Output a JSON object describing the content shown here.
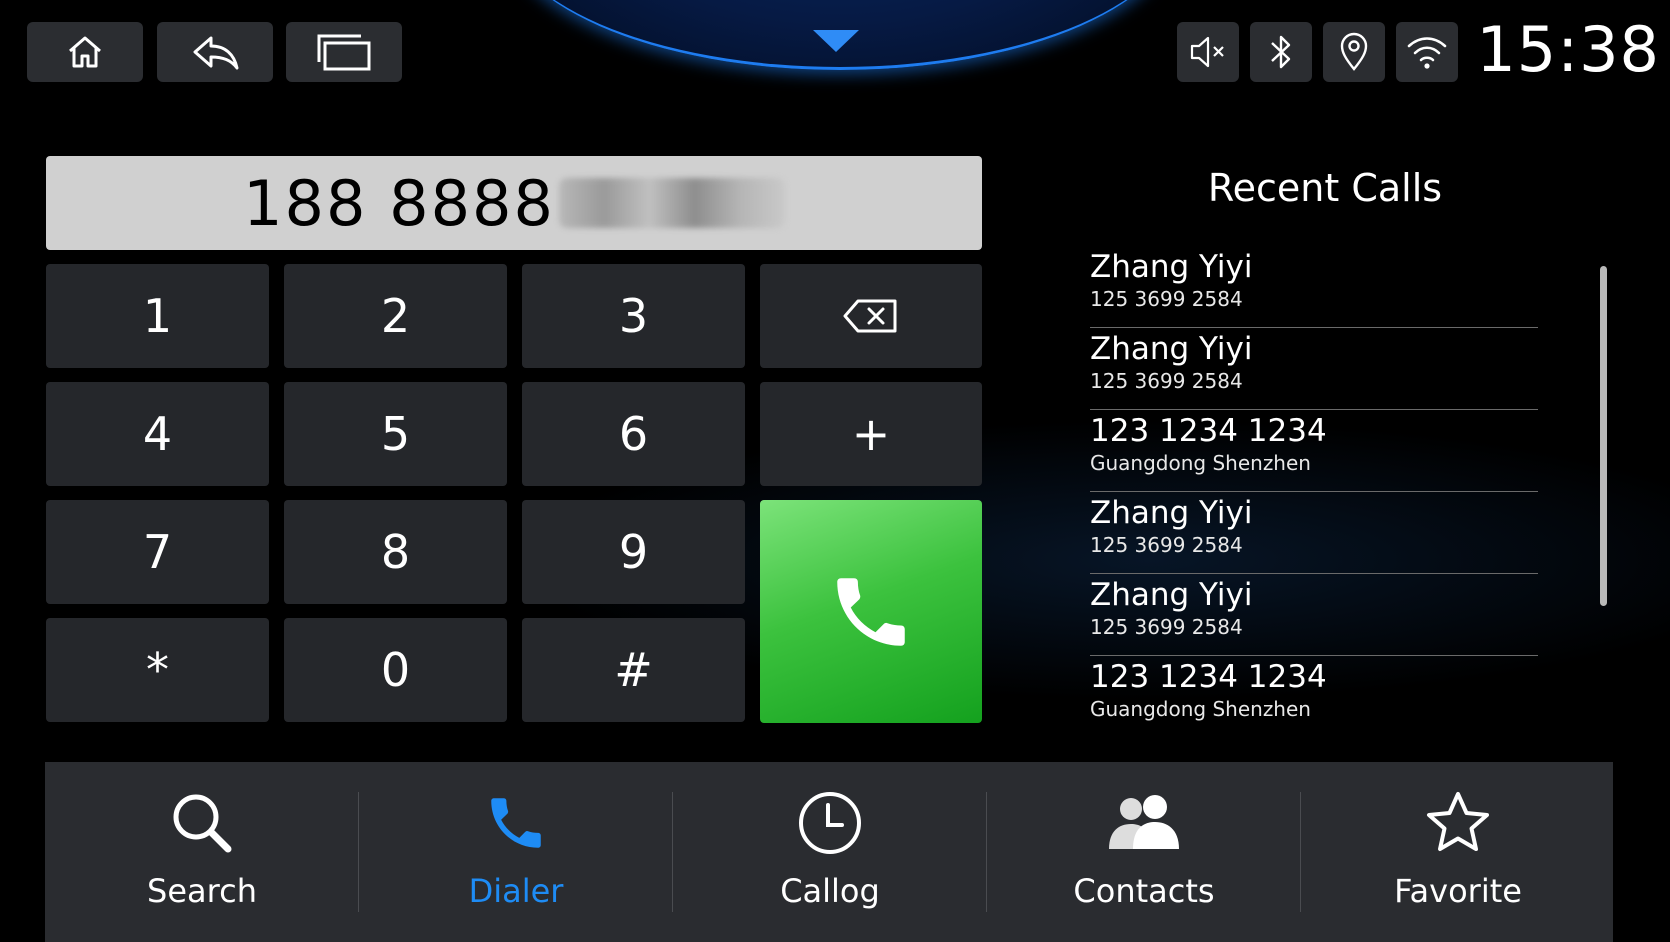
{
  "nav": {
    "home": "home-icon",
    "back": "back-icon",
    "recents": "recent-apps-icon"
  },
  "status": {
    "icons": [
      "mute-icon",
      "bluetooth-icon",
      "location-icon",
      "wifi-icon"
    ],
    "time": "15:38"
  },
  "dialer": {
    "number_visible": "188 8888",
    "keys": [
      "1",
      "2",
      "3",
      "4",
      "5",
      "6",
      "7",
      "8",
      "9",
      "*",
      "0",
      "#",
      "+"
    ],
    "call_color": "#2fbf36"
  },
  "recent_calls": {
    "title": "Recent Calls",
    "items": [
      {
        "name": "Zhang Yiyi",
        "sub": "125 3699 2584"
      },
      {
        "name": "Zhang Yiyi",
        "sub": "125 3699 2584"
      },
      {
        "name": "123 1234 1234",
        "sub": "Guangdong Shenzhen"
      },
      {
        "name": "Zhang Yiyi",
        "sub": "125 3699 2584"
      },
      {
        "name": "Zhang Yiyi",
        "sub": "125 3699 2584"
      },
      {
        "name": "123 1234 1234",
        "sub": "Guangdong Shenzhen"
      }
    ]
  },
  "tabs": [
    {
      "label": "Search",
      "icon": "search-icon"
    },
    {
      "label": "Dialer",
      "icon": "phone-icon",
      "active": true
    },
    {
      "label": "Callog",
      "icon": "clock-icon"
    },
    {
      "label": "Contacts",
      "icon": "contacts-icon"
    },
    {
      "label": "Favorite",
      "icon": "star-icon"
    }
  ],
  "accent": "#1e8cf5"
}
